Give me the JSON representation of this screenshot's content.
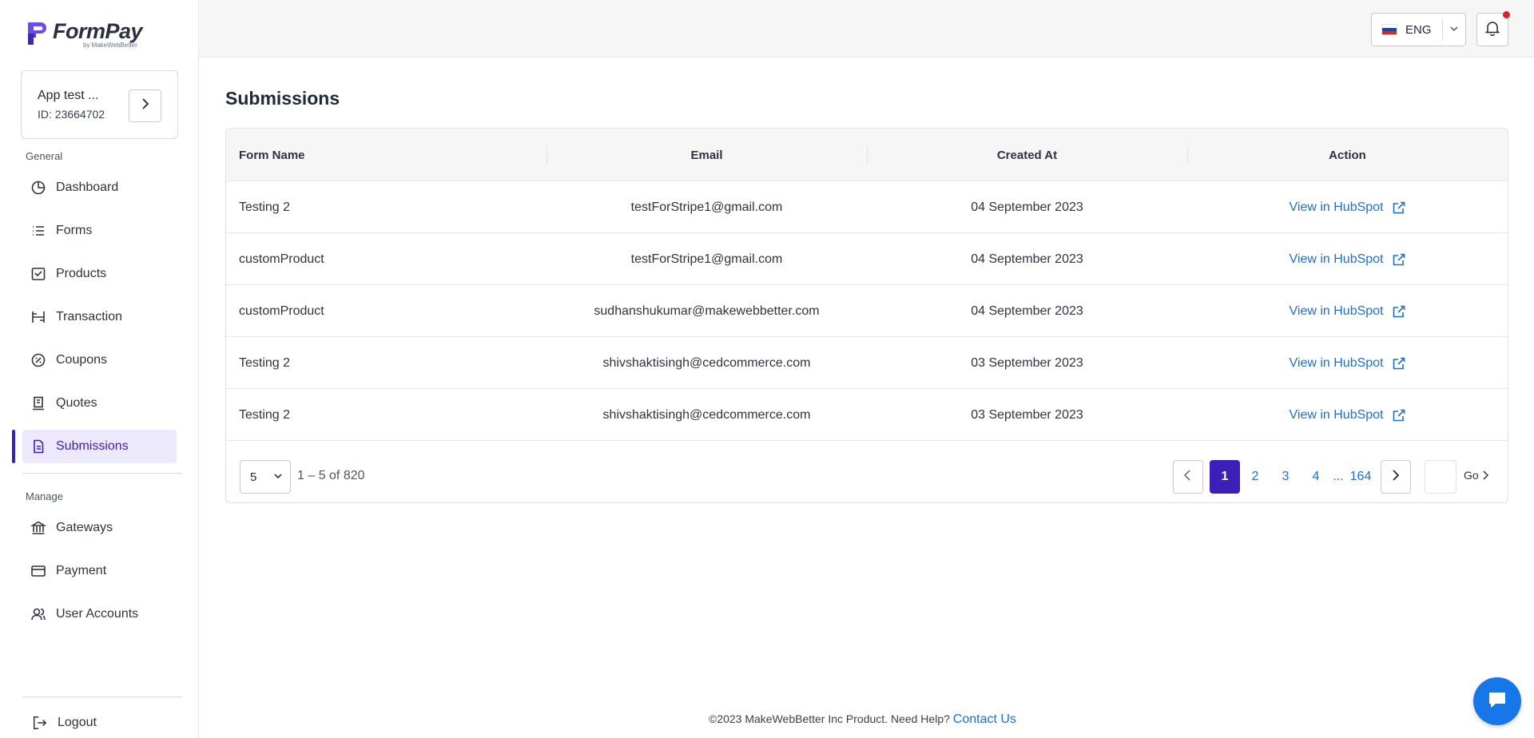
{
  "brand": {
    "name": "FormPay",
    "byline": "by MakeWebBetter",
    "accent": "#3b1fb8",
    "link_color": "#1d6fd8"
  },
  "app_card": {
    "name": "App test ...",
    "id_text": "ID: 23664702"
  },
  "sidebar": {
    "general_label": "General",
    "general_items": [
      {
        "label": "Dashboard",
        "icon": "pie-chart-icon"
      },
      {
        "label": "Forms",
        "icon": "list-icon"
      },
      {
        "label": "Products",
        "icon": "product-tag-icon"
      },
      {
        "label": "Transaction",
        "icon": "transaction-icon"
      },
      {
        "label": "Coupons",
        "icon": "coupon-icon"
      },
      {
        "label": "Quotes",
        "icon": "quote-icon"
      },
      {
        "label": "Submissions",
        "icon": "document-icon",
        "active": true
      }
    ],
    "manage_label": "Manage",
    "manage_items": [
      {
        "label": "Gateways",
        "icon": "bank-icon"
      },
      {
        "label": "Payment",
        "icon": "credit-card-icon"
      },
      {
        "label": "User Accounts",
        "icon": "users-icon"
      }
    ],
    "logout_label": "Logout"
  },
  "topbar": {
    "language": "ENG",
    "flag_colors": [
      "#ffffff",
      "#1c3fa8",
      "#d52b1e"
    ],
    "notification_dot_color": "#e01e2b"
  },
  "main": {
    "title": "Submissions",
    "columns": [
      "Form Name",
      "Email",
      "Created At",
      "Action"
    ],
    "rows": [
      {
        "form_name": "Testing 2",
        "email": "testForStripe1@gmail.com",
        "created_at": "04 September 2023",
        "action": "View in HubSpot"
      },
      {
        "form_name": "customProduct",
        "email": "testForStripe1@gmail.com",
        "created_at": "04 September 2023",
        "action": "View in HubSpot"
      },
      {
        "form_name": "customProduct",
        "email": "sudhanshukumar@makewebbetter.com",
        "created_at": "04 September 2023",
        "action": "View in HubSpot"
      },
      {
        "form_name": "Testing 2",
        "email": "shivshaktisingh@cedcommerce.com",
        "created_at": "03 September 2023",
        "action": "View in HubSpot"
      },
      {
        "form_name": "Testing 2",
        "email": "shivshaktisingh@cedcommerce.com",
        "created_at": "03 September 2023",
        "action": "View in HubSpot"
      }
    ],
    "pagination": {
      "page_size": "5",
      "range_text": "1 – 5 of 820",
      "pages": [
        "1",
        "2",
        "3",
        "4"
      ],
      "current_page": "1",
      "ellipsis": "...",
      "last_page": "164",
      "go_label": "Go"
    }
  },
  "footer": {
    "text": "©2023 MakeWebBetter Inc Product. Need Help?",
    "link": "Contact Us"
  }
}
